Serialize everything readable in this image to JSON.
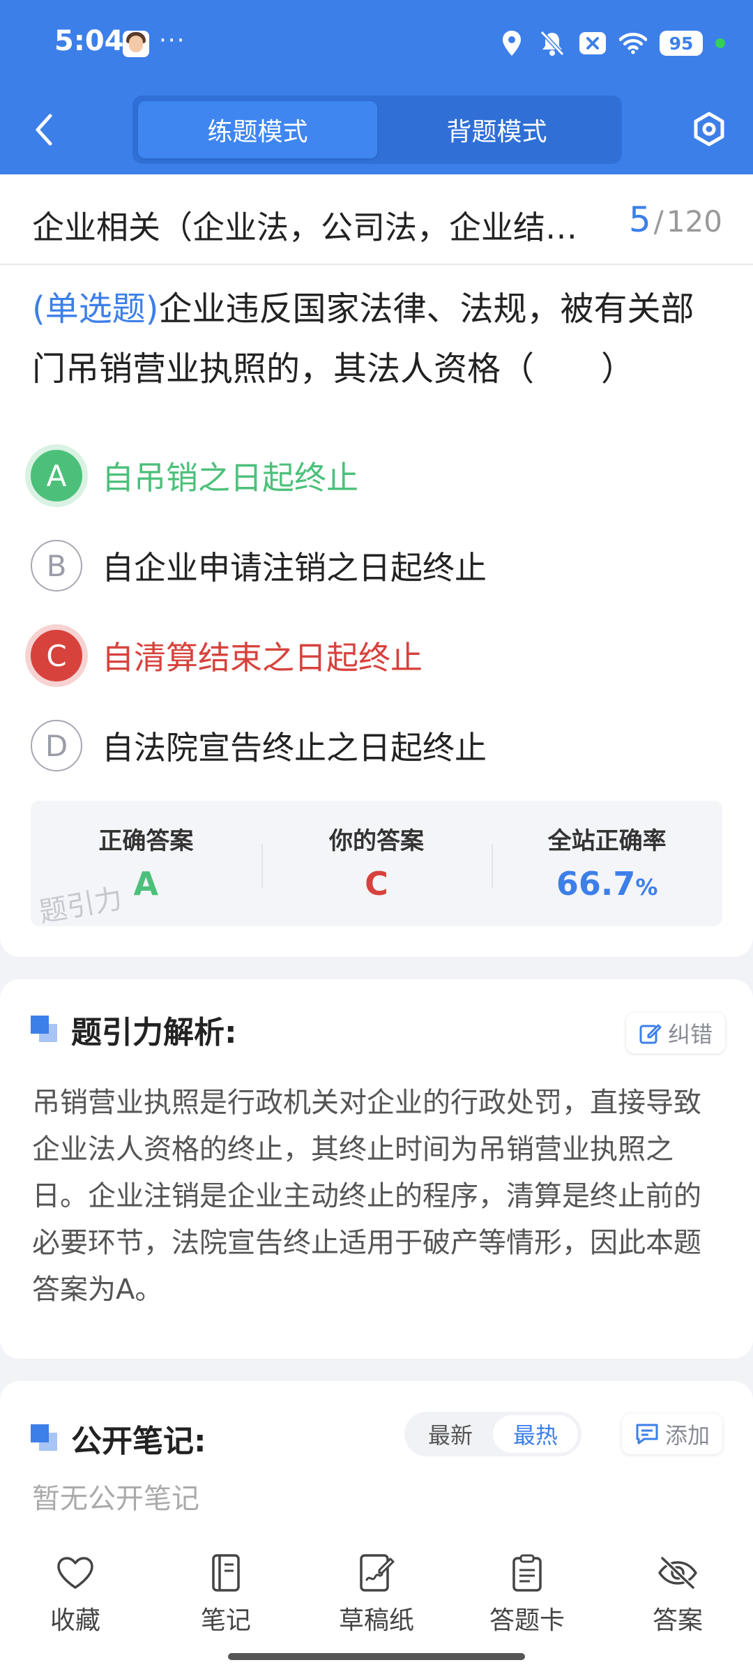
{
  "status_bar": {
    "time": "5:04",
    "more": "···",
    "battery": "95"
  },
  "header": {
    "modes": [
      {
        "label": "练题模式",
        "active": true
      },
      {
        "label": "背题模式",
        "active": false
      }
    ]
  },
  "question": {
    "category_title": "企业相关（企业法，公司法，企业结…",
    "current": "5",
    "separator": "/",
    "total": "120",
    "type_label": "(单选题)",
    "stem": "企业违反国家法律、法规，被有关部门吊销营业执照的，其法人资格（　　）",
    "options": [
      {
        "letter": "A",
        "text": "自吊销之日起终止",
        "state": "correct"
      },
      {
        "letter": "B",
        "text": "自企业申请注销之日起终止",
        "state": "normal"
      },
      {
        "letter": "C",
        "text": "自清算结束之日起终止",
        "state": "wrong"
      },
      {
        "letter": "D",
        "text": "自法院宣告终止之日起终止",
        "state": "normal"
      }
    ]
  },
  "answer_summary": {
    "correct_label": "正确答案",
    "correct_value": "A",
    "yours_label": "你的答案",
    "yours_value": "C",
    "rate_label": "全站正确率",
    "rate_value": "66.7",
    "rate_unit": "%",
    "watermark": "题引力",
    "colors": {
      "correct": "#4cc07a",
      "wrong": "#d7423d",
      "accent": "#3d7fe9"
    }
  },
  "analysis": {
    "title": "题引力解析:",
    "report_label": "纠错",
    "text": "吊销营业执照是行政机关对企业的行政处罚，直接导致企业法人资格的终止，其终止时间为吊销营业执照之日。企业注销是企业主动终止的程序，清算是终止前的必要环节，法院宣告终止适用于破产等情形，因此本题答案为A。"
  },
  "notes": {
    "title": "公开笔记:",
    "sort_options": [
      {
        "label": "最新",
        "active": false
      },
      {
        "label": "最热",
        "active": true
      }
    ],
    "add_label": "添加",
    "empty_text": "暂无公开笔记"
  },
  "toolbar": {
    "items": [
      {
        "label": "收藏",
        "icon": "heart-icon"
      },
      {
        "label": "笔记",
        "icon": "notebook-icon"
      },
      {
        "label": "草稿纸",
        "icon": "draft-paper-icon"
      },
      {
        "label": "答题卡",
        "icon": "answer-card-icon"
      },
      {
        "label": "答案",
        "icon": "eye-off-icon"
      }
    ]
  }
}
